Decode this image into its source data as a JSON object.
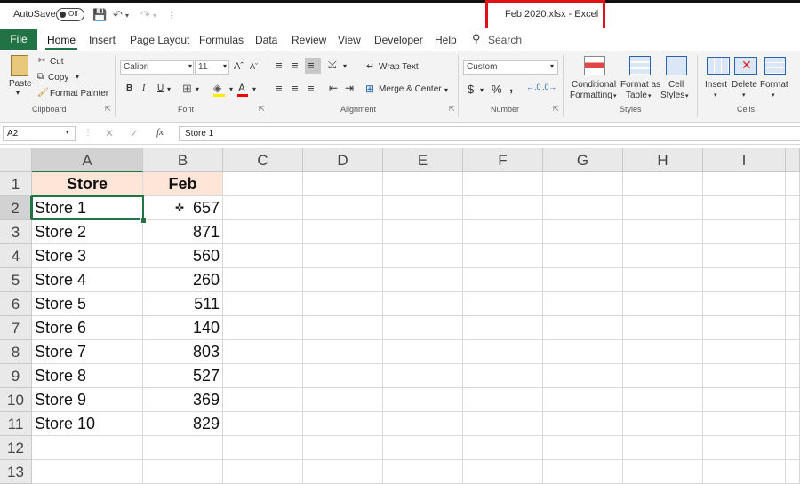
{
  "titlebar": {
    "autosave_label": "AutoSave",
    "autosave_state": "Off",
    "document_title": "Feb 2020.xlsx  -  Excel"
  },
  "tabs": [
    "File",
    "Home",
    "Insert",
    "Page Layout",
    "Formulas",
    "Data",
    "Review",
    "View",
    "Developer",
    "Help"
  ],
  "search_placeholder": "Search",
  "ribbon": {
    "clipboard": {
      "paste": "Paste",
      "cut": "Cut",
      "copy": "Copy",
      "format_painter": "Format Painter",
      "group": "Clipboard"
    },
    "font": {
      "name": "Calibri",
      "size": "11",
      "bold": "B",
      "italic": "I",
      "underline": "U",
      "group": "Font"
    },
    "alignment": {
      "wrap_text": "Wrap Text",
      "merge_center": "Merge & Center",
      "group": "Alignment"
    },
    "number": {
      "format": "Custom",
      "currency": "$",
      "percent": "%",
      "comma": ",",
      "group": "Number"
    },
    "styles": {
      "conditional": "Conditional",
      "formatting": "Formatting",
      "format_as": "Format as",
      "table": "Table",
      "cell": "Cell",
      "styles": "Styles",
      "group": "Styles"
    },
    "cells": {
      "insert": "Insert",
      "delete": "Delete",
      "format": "Format",
      "group": "Cells"
    }
  },
  "formula_bar": {
    "name_box": "A2",
    "fx": "fx",
    "content": "Store 1"
  },
  "columns": [
    "A",
    "B",
    "C",
    "D",
    "E",
    "F",
    "G",
    "H",
    "I"
  ],
  "rows": [
    "1",
    "2",
    "3",
    "4",
    "5",
    "6",
    "7",
    "8",
    "9",
    "10",
    "11",
    "12",
    "13"
  ],
  "sheet": {
    "header": {
      "a": "Store",
      "b": "Feb"
    },
    "data": [
      {
        "a": "Store 1",
        "b": "657"
      },
      {
        "a": "Store 2",
        "b": "871"
      },
      {
        "a": "Store 3",
        "b": "560"
      },
      {
        "a": "Store 4",
        "b": "260"
      },
      {
        "a": "Store 5",
        "b": "511"
      },
      {
        "a": "Store 6",
        "b": "140"
      },
      {
        "a": "Store 7",
        "b": "803"
      },
      {
        "a": "Store 8",
        "b": "527"
      },
      {
        "a": "Store 9",
        "b": "369"
      },
      {
        "a": "Store 10",
        "b": "829"
      }
    ]
  },
  "colors": {
    "accent": "#217346",
    "highlight_box": "#e0101a",
    "header_fill": "#fde6d8"
  }
}
